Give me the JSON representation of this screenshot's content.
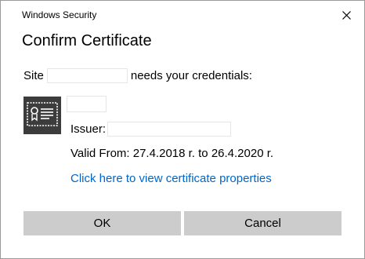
{
  "window": {
    "app_title": "Windows Security",
    "heading": "Confirm Certificate",
    "close_icon": "close-icon"
  },
  "body": {
    "site_prefix": "Site",
    "site_suffix": "needs your credentials:",
    "issuer_label": "Issuer:",
    "valid_from": "Valid From: 27.4.2018 r. to 26.4.2020 r.",
    "view_link": "Click here to view certificate properties",
    "cert_icon": "certificate-icon"
  },
  "buttons": {
    "ok": "OK",
    "cancel": "Cancel"
  },
  "colors": {
    "link": "#0066cc",
    "button_bg": "#cccccc",
    "icon_bg": "#3c3c3c"
  }
}
